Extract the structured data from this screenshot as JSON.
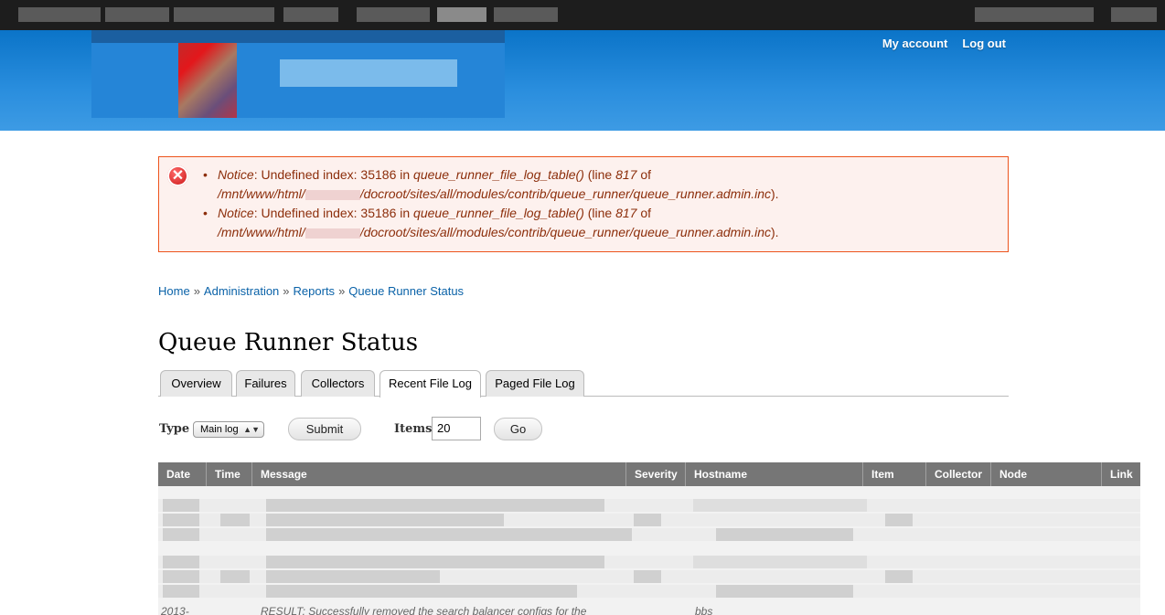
{
  "user_nav": {
    "my_account": "My account",
    "log_out": "Log out"
  },
  "messages": [
    {
      "label": "Notice",
      "text_1": ": Undefined index: 35186 in ",
      "function": "queue_runner_file_log_table()",
      "text_2": " (line ",
      "line": "817",
      "text_3": " of",
      "path_start": "/mnt/www/html/",
      "path_end": "/docroot/sites/all/modules/contrib/queue_runner/queue_runner.admin.inc",
      "text_4": ")."
    },
    {
      "label": "Notice",
      "text_1": ": Undefined index: 35186 in ",
      "function": "queue_runner_file_log_table()",
      "text_2": " (line ",
      "line": "817",
      "text_3": " of",
      "path_start": "/mnt/www/html/",
      "path_end": "/docroot/sites/all/modules/contrib/queue_runner/queue_runner.admin.inc",
      "text_4": ")."
    }
  ],
  "breadcrumb": {
    "items": [
      "Home",
      "Administration",
      "Reports",
      "Queue Runner Status"
    ],
    "separator": "»"
  },
  "page_title": "Queue Runner Status",
  "tabs": [
    {
      "label": "Overview",
      "active": false
    },
    {
      "label": "Failures",
      "active": false
    },
    {
      "label": "Collectors",
      "active": false
    },
    {
      "label": "Recent File Log",
      "active": true
    },
    {
      "label": "Paged File Log",
      "active": false
    }
  ],
  "filter": {
    "type_label": "Type",
    "type_value": "Main log",
    "submit_label": "Submit",
    "items_label": "Items",
    "items_value": "20",
    "go_label": "Go"
  },
  "table": {
    "headers": [
      "Date",
      "Time",
      "Message",
      "Severity",
      "Hostname",
      "Item",
      "Collector",
      "Node",
      "Link"
    ],
    "partial_row": {
      "date": "2013-",
      "message": "RESULT: Successfully removed the search balancer configs for the",
      "hostname": "bbs"
    }
  }
}
